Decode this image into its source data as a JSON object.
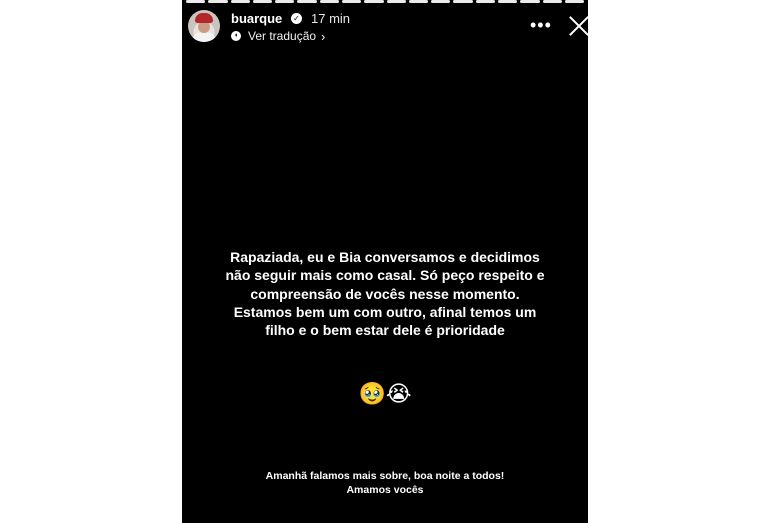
{
  "story": {
    "segment_count": 18,
    "completed_segments": 18,
    "header": {
      "username": "buarque",
      "verified_icon": "check-icon",
      "time": "17 min",
      "translate_label": "Ver tradução",
      "more_icon": "more-icon",
      "close_icon": "close-icon"
    },
    "message": {
      "line1": "Rapaziada, eu e Bia conversamos e decidimos",
      "line2": "não seguir mais como casal. Só peço respeito e",
      "line3": "compreensão de vocês nesse momento.",
      "line4": "Estamos bem um com outro, afinal temos um",
      "line5": "filho e o bem estar dele é prioridade"
    },
    "emojis": "🥹😭",
    "footer": {
      "line1": "Amanhã falamos mais sobre, boa noite a todos!",
      "line2": "Amamos vocês"
    }
  },
  "colors": {
    "background": "#000000",
    "text": "#ffffff",
    "progress_active": "#eaeaea",
    "progress_inactive": "#8a8a8a"
  }
}
